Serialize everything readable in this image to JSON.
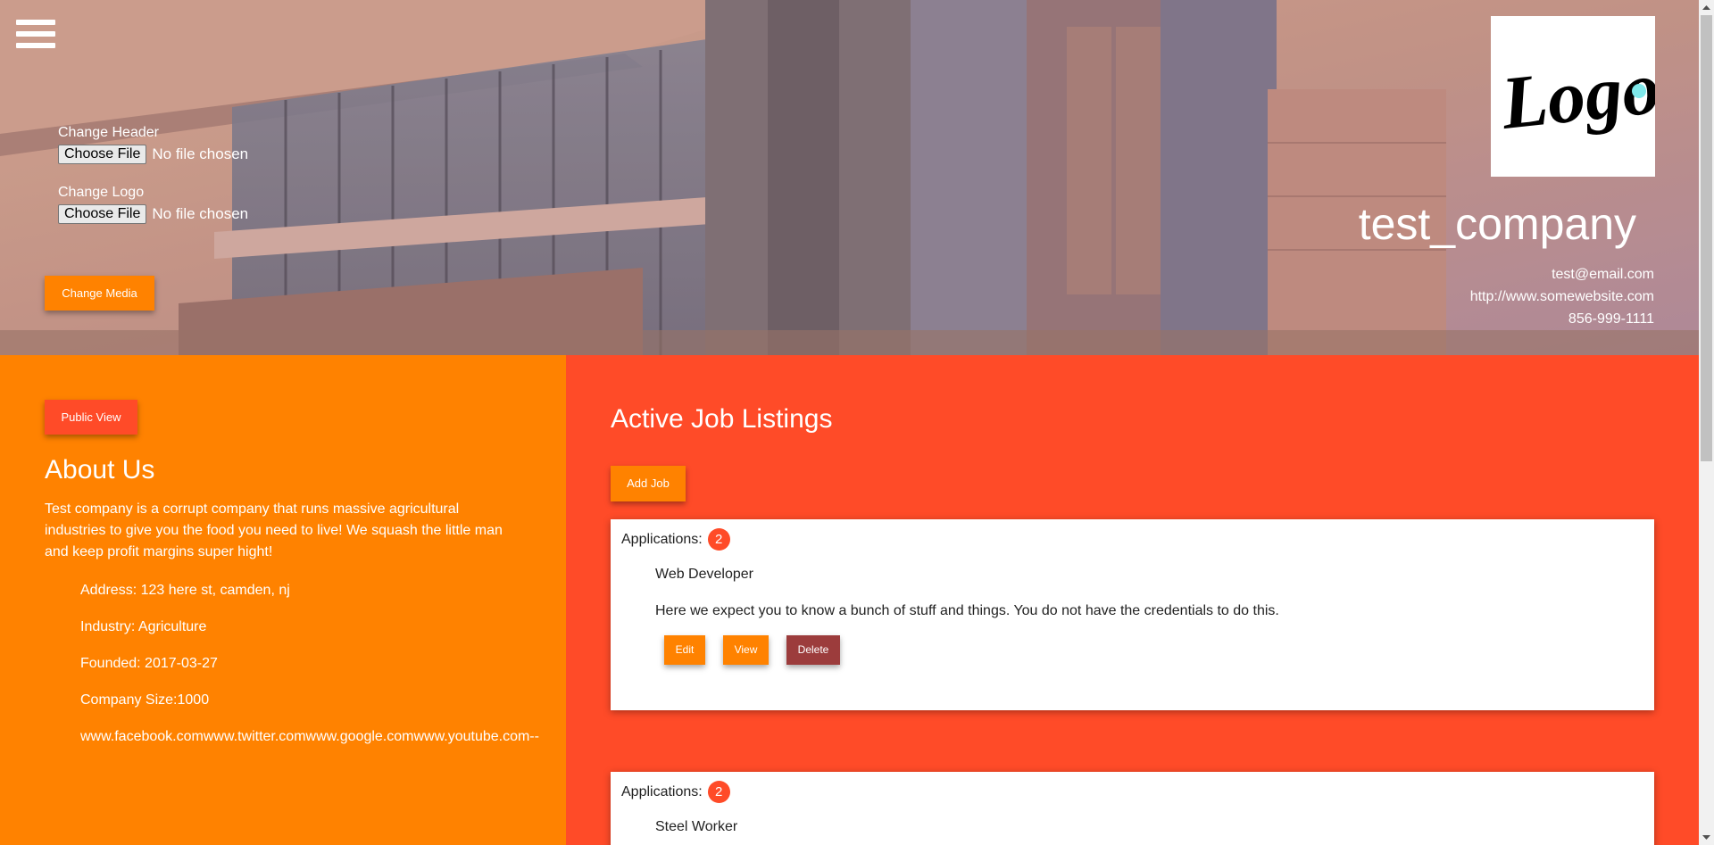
{
  "header": {
    "menu_icon": "hamburger-menu-icon",
    "change_header_label": "Change Header",
    "change_logo_label": "Change Logo",
    "choose_file_label": "Choose File",
    "no_file_text": "No file chosen",
    "change_media_label": "Change Media",
    "logo_text": "Logo",
    "company_name": "test_company",
    "email": "test@email.com",
    "website": "http://www.somewebsite.com",
    "phone": "856-999-1111"
  },
  "about": {
    "public_view_label": "Public View",
    "title": "About Us",
    "description": "Test company is a corrupt company that runs massive agricultural industries to give you the food you need to live! We squash the little man and keep profit margins super hight!",
    "address": "Address: 123 here st, camden, nj",
    "industry": "Industry: Agriculture",
    "founded": "Founded: 2017-03-27",
    "company_size": "Company Size:1000",
    "social_links": "www.facebook.comwww.twitter.comwww.google.comwww.youtube.com--"
  },
  "jobs": {
    "title": "Active Job Listings",
    "add_job_label": "Add Job",
    "applications_label": "Applications:",
    "edit_label": "Edit",
    "view_label": "View",
    "delete_label": "Delete",
    "listings": [
      {
        "applications": "2",
        "title": "Web Developer",
        "description": "Here we expect you to know a bunch of stuff and things. You do not have the credentials to do this."
      },
      {
        "applications": "2",
        "title": "Steel Worker",
        "description": ""
      }
    ]
  },
  "colors": {
    "orange": "#ff8200",
    "red": "#ff4b28",
    "dark_red": "#9c3c3c"
  }
}
